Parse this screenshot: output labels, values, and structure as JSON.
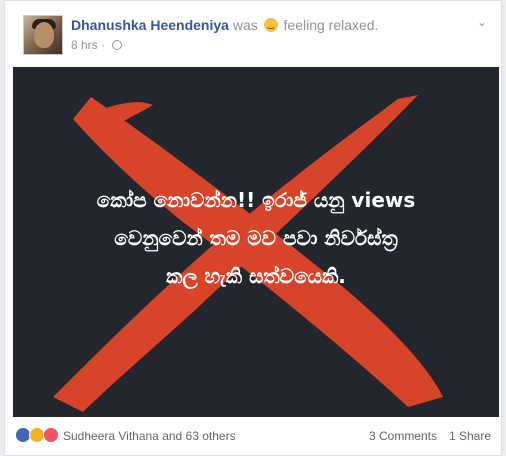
{
  "post": {
    "author": "Dhanushka Heendeniya",
    "action_prefix": "was",
    "feeling": "feeling relaxed.",
    "time": "8 hrs",
    "privacy_icon": "globe-icon",
    "options_icon": "chevron-down-icon"
  },
  "image": {
    "line1": "කෝප නොවන්න!! ඉරාජ් යනු views",
    "line2": "වෙනුවෙන් තම මව පවා නිර්වස්ත්‍ර",
    "line3": "කල හැකි සත්වයෙකි.",
    "background_color": "#23272d",
    "cross_color": "#d8442a"
  },
  "footer": {
    "reaction_text": "Sudheera Vithana and 63 others",
    "comments": "3 Comments",
    "shares": "1 Share",
    "reactions": [
      "like-icon",
      "haha-icon",
      "love-icon"
    ]
  }
}
